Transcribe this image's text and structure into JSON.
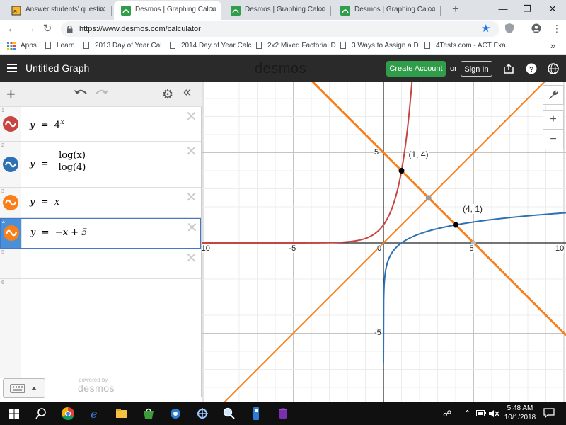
{
  "browser": {
    "tabs": [
      {
        "title": "Answer students' questio",
        "active": false
      },
      {
        "title": "Desmos | Graphing Calcu",
        "active": true
      },
      {
        "title": "Desmos | Graphing Calcu",
        "active": false
      },
      {
        "title": "Desmos | Graphing Calcu",
        "active": false
      }
    ],
    "url": "https://www.desmos.com/calculator",
    "bookmarks": [
      "Apps",
      "Learn",
      "2013 Day of Year Cal",
      "2014 Day of Year Calc",
      "2x2 Mixed Factorial D",
      "3 Ways to Assign a D",
      "4Tests.com - ACT Exa"
    ],
    "more_bookmarks": "»"
  },
  "desmos": {
    "graph_title": "Untitled Graph",
    "brand": "desmos",
    "create_account": "Create Account",
    "or_label": "or",
    "sign_in": "Sign In",
    "powered_by": "powered by",
    "powered_brand": "desmos"
  },
  "expressions": [
    {
      "num": "1",
      "color": "#c74440",
      "lhs": "y",
      "eq": "=",
      "base": "4",
      "exp": "x"
    },
    {
      "num": "2",
      "color": "#2d70b3",
      "lhs": "y",
      "eq": "=",
      "numer": "log(x)",
      "denom": "log(4)"
    },
    {
      "num": "3",
      "color": "#fa7e19",
      "lhs": "y",
      "eq": "=",
      "rhs": "x"
    },
    {
      "num": "4",
      "color": "#fa7e19",
      "lhs": "y",
      "eq": "=",
      "rhs": "−x + 5"
    },
    {
      "num": "5"
    },
    {
      "num": "6"
    }
  ],
  "graph": {
    "x_ticks": [
      "-10",
      "-5",
      "0",
      "5",
      "10"
    ],
    "y_ticks": [
      "5",
      "-5"
    ],
    "points": [
      {
        "label": "(1, 4)",
        "x": 1,
        "y": 4
      },
      {
        "label": "(4, 1)",
        "x": 4,
        "y": 1
      }
    ],
    "zoom_in": "+",
    "zoom_out": "−"
  },
  "taskbar": {
    "time": "5:48 AM",
    "date": "10/1/2018"
  },
  "colors": {
    "red": "#c74440",
    "blue": "#2d70b3",
    "orange": "#fa7e19",
    "green_button": "#2f9d49",
    "header": "#2a2a2a"
  }
}
